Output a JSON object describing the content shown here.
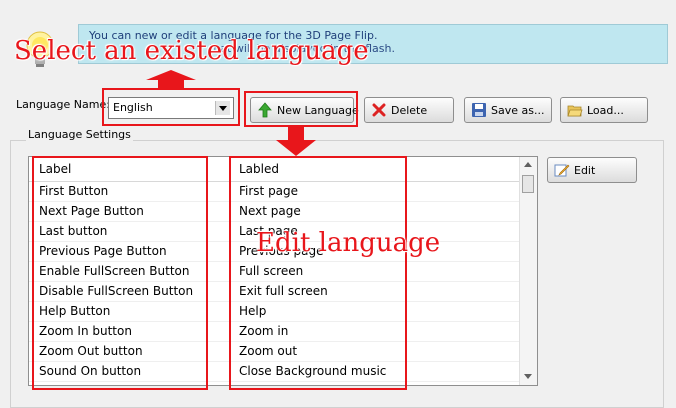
{
  "info": {
    "line1": "You can new or edit  a language for the 3D Page Flip.",
    "line2": "...",
    "line3": "that will be displayed in the flash."
  },
  "form": {
    "language_name_label": "Language Name:",
    "language_selected": "English",
    "buttons": {
      "new_language": "New Language",
      "delete": "Delete",
      "save_as": "Save as...",
      "load": "Load..."
    }
  },
  "settings": {
    "group_title": "Language Settings",
    "columns": [
      "Label",
      "Labled"
    ],
    "rows": [
      {
        "label": "First Button",
        "labled": "First page"
      },
      {
        "label": "Next Page Button",
        "labled": "Next page"
      },
      {
        "label": "Last button",
        "labled": "Last page"
      },
      {
        "label": "Previous Page Button",
        "labled": "Previous page"
      },
      {
        "label": "Enable FullScreen Button",
        "labled": "Full screen"
      },
      {
        "label": "Disable FullScreen Button",
        "labled": "Exit full screen"
      },
      {
        "label": "Help Button",
        "labled": "Help"
      },
      {
        "label": "Zoom In button",
        "labled": "Zoom in"
      },
      {
        "label": "Zoom Out button",
        "labled": "Zoom out"
      },
      {
        "label": "Sound On button",
        "labled": "Close Background music"
      }
    ],
    "edit_button": "Edit"
  },
  "annotations": {
    "select_language": "Select an existed language",
    "edit_language": "Edit language"
  },
  "colors": {
    "annotation_red": "#e8161b",
    "info_background": "#bfe7f0"
  }
}
